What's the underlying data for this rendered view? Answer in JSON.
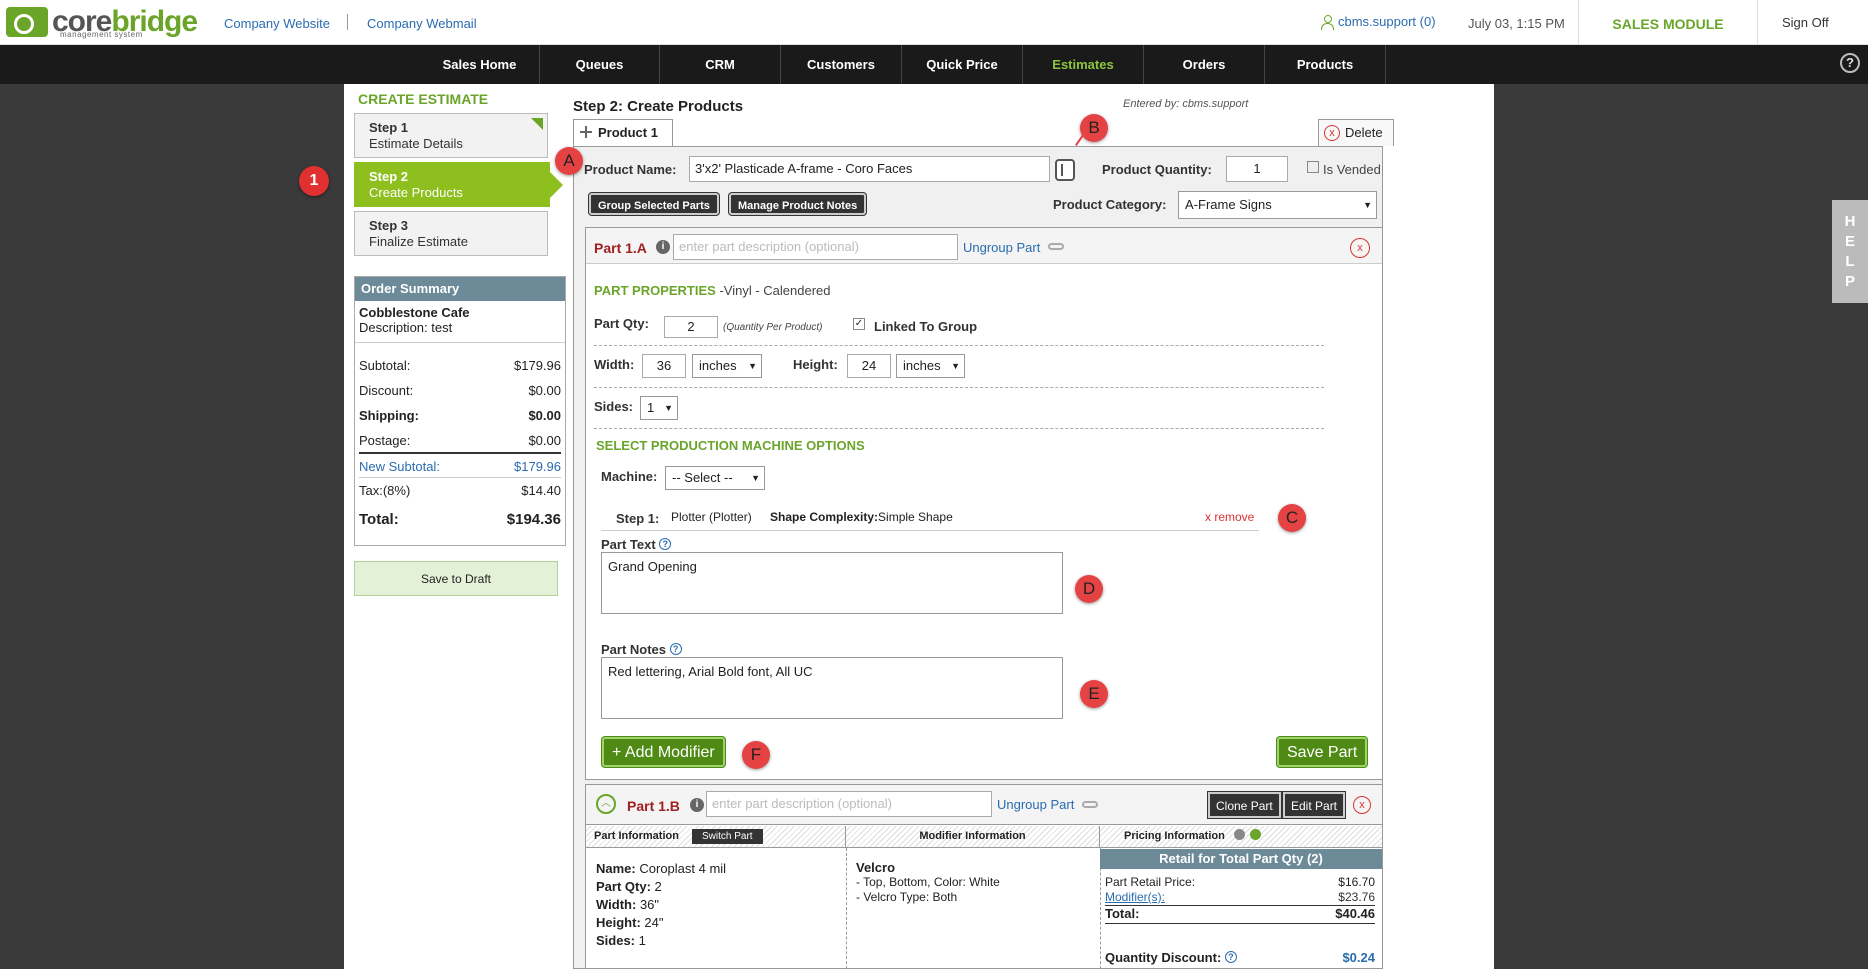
{
  "brand": {
    "name_a": "core",
    "name_b": "bridge",
    "tagline": "management system"
  },
  "header": {
    "links": [
      "Company Website",
      "Company Webmail"
    ],
    "user": "cbms.support (0)",
    "datetime": "July 03, 1:15 PM",
    "module": "SALES MODULE",
    "signoff": "Sign Off"
  },
  "nav": [
    "Sales Home",
    "Queues",
    "CRM",
    "Customers",
    "Quick Price",
    "Estimates",
    "Orders",
    "Products"
  ],
  "sidebar": {
    "title": "CREATE ESTIMATE",
    "steps": [
      {
        "title": "Step 1",
        "sub": "Estimate Details"
      },
      {
        "title": "Step 2",
        "sub": "Create Products"
      },
      {
        "title": "Step 3",
        "sub": "Finalize Estimate"
      }
    ],
    "badge": "1"
  },
  "summary": {
    "title": "Order Summary",
    "customer": "Cobblestone Cafe",
    "description": "Description:  test",
    "rows": [
      {
        "label": "Subtotal:",
        "value": "$179.96"
      },
      {
        "label": "Discount:",
        "value": "$0.00"
      },
      {
        "label": "Shipping:",
        "value": "$0.00"
      },
      {
        "label": "Postage:",
        "value": "$0.00"
      },
      {
        "label": "New Subtotal:",
        "value": "$179.96"
      },
      {
        "label": "Tax:(8%)",
        "value": "$14.40"
      },
      {
        "label": "Total:",
        "value": "$194.36"
      }
    ],
    "save_draft": "Save to Draft"
  },
  "main": {
    "title": "Step 2: Create Products",
    "entered_by": "Entered by: cbms.support",
    "tab": "Product 1",
    "delete": "Delete",
    "product_name_label": "Product Name:",
    "product_name": "3'x2' Plasticade A-frame - Coro Faces",
    "qty_label": "Product Quantity:",
    "qty": "1",
    "is_vended": "Is Vended",
    "group_btn": "Group Selected Parts",
    "notes_btn": "Manage Product Notes",
    "category_label": "Product Category:",
    "category": "A-Frame Signs"
  },
  "part_a": {
    "label": "Part 1.A",
    "desc_placeholder": "enter part description (optional)",
    "ungroup": "Ungroup Part",
    "props_title": "PART PROPERTIES",
    "props_sub": "-Vinyl - Calendered",
    "qty_label": "Part Qty:",
    "qty": "2",
    "qty_note": "(Quantity Per Product)",
    "linked": "Linked To Group",
    "width_label": "Width:",
    "width": "36",
    "height_label": "Height:",
    "height": "24",
    "unit": "inches",
    "sides_label": "Sides:",
    "sides": "1",
    "machine_title": "SELECT PRODUCTION MACHINE OPTIONS",
    "machine_label": "Machine:",
    "machine": "-- Select --",
    "step1_label": "Step 1:",
    "step1_value": "Plotter (Plotter)",
    "shape_label": "Shape Complexity:",
    "shape_value": "Simple Shape",
    "remove": "x remove",
    "text_label": "Part Text",
    "text_value": "Grand Opening",
    "notes_label": "Part Notes",
    "notes_value": "Red lettering, Arial Bold font, All UC",
    "add_modifier": "+ Add Modifier",
    "save_part": "Save Part"
  },
  "part_b": {
    "label": "Part 1.B",
    "desc_placeholder": "enter part description (optional)",
    "ungroup": "Ungroup Part",
    "clone": "Clone Part",
    "edit": "Edit Part",
    "col_info": "Part Information",
    "switch": "Switch Part",
    "col_mod": "Modifier Information",
    "col_price": "Pricing Information",
    "info": [
      {
        "k": "Name:",
        "v": "Coroplast 4 mil"
      },
      {
        "k": "Part Qty:",
        "v": "2"
      },
      {
        "k": "Width:",
        "v": "36\""
      },
      {
        "k": "Height:",
        "v": "24\""
      },
      {
        "k": "Sides:",
        "v": "1"
      }
    ],
    "mod_name": "Velcro",
    "mod_lines": [
      "- Top, Bottom, Color: White",
      "- Velcro Type: Both"
    ],
    "retail_head": "Retail for Total Part Qty (2)",
    "retail_rows": [
      {
        "k": "Part Retail Price:",
        "v": "$16.70"
      },
      {
        "k": "Modifier(s):",
        "v": "$23.76"
      },
      {
        "k": "Total:",
        "v": "$40.46"
      }
    ],
    "qty_discount": "Quantity Discount:",
    "qty_discount_value": "$0.24"
  },
  "callouts": [
    "A",
    "B",
    "C",
    "D",
    "E",
    "F"
  ],
  "help_side": [
    "H",
    "E",
    "L",
    "P"
  ],
  "help_q": "?"
}
